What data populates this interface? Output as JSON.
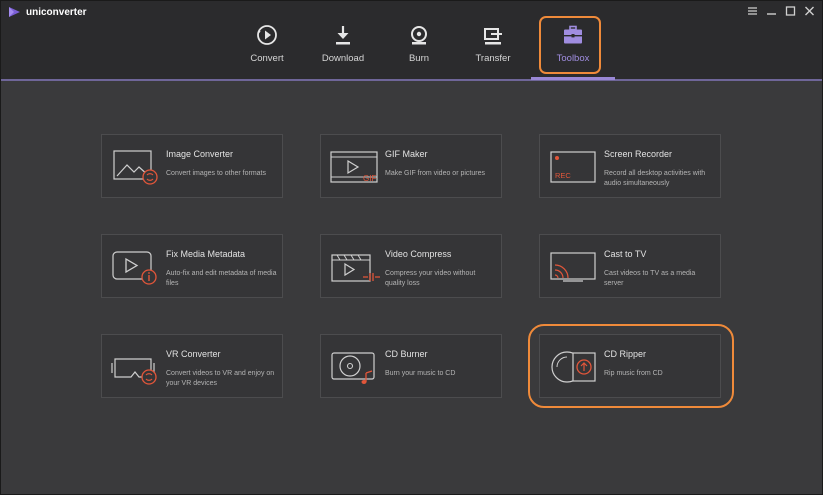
{
  "app": {
    "name": "uniconverter"
  },
  "window_controls": [
    "menu-icon",
    "minimize-icon",
    "maximize-icon",
    "close-icon"
  ],
  "nav": {
    "active": "Toolbox",
    "tabs": [
      {
        "id": "convert",
        "label": "Convert",
        "icon": "convert-icon"
      },
      {
        "id": "download",
        "label": "Download",
        "icon": "download-icon"
      },
      {
        "id": "burn",
        "label": "Burn",
        "icon": "burn-icon"
      },
      {
        "id": "transfer",
        "label": "Transfer",
        "icon": "transfer-icon"
      },
      {
        "id": "toolbox",
        "label": "Toolbox",
        "icon": "toolbox-icon"
      }
    ]
  },
  "tools": [
    {
      "title": "Image Converter",
      "desc": "Convert images to other formats",
      "icon": "image-converter-icon"
    },
    {
      "title": "GIF Maker",
      "desc": "Make GIF from video or pictures",
      "icon": "gif-maker-icon",
      "icon_text": "GIF"
    },
    {
      "title": "Screen Recorder",
      "desc": "Record all desktop activities with audio simultaneously",
      "icon": "screen-recorder-icon",
      "icon_text": "REC"
    },
    {
      "title": "Fix Media Metadata",
      "desc": "Auto-fix and edit metadata of media files",
      "icon": "metadata-icon"
    },
    {
      "title": "Video Compress",
      "desc": "Compress your video without quality loss",
      "icon": "video-compress-icon"
    },
    {
      "title": "Cast to TV",
      "desc": "Cast videos to TV as a media server",
      "icon": "cast-tv-icon"
    },
    {
      "title": "VR Converter",
      "desc": "Convert videos to VR and enjoy on your VR devices",
      "icon": "vr-converter-icon"
    },
    {
      "title": "CD Burner",
      "desc": "Burn your music to CD",
      "icon": "cd-burner-icon"
    },
    {
      "title": "CD Ripper",
      "desc": "Rip music from CD",
      "icon": "cd-ripper-icon"
    }
  ],
  "colors": {
    "background": "#3a3a3c",
    "topbar": "#2b2b2d",
    "accent": "#9a88d6",
    "highlight": "#ef8a3a",
    "icon_badge": "#e2563a"
  }
}
